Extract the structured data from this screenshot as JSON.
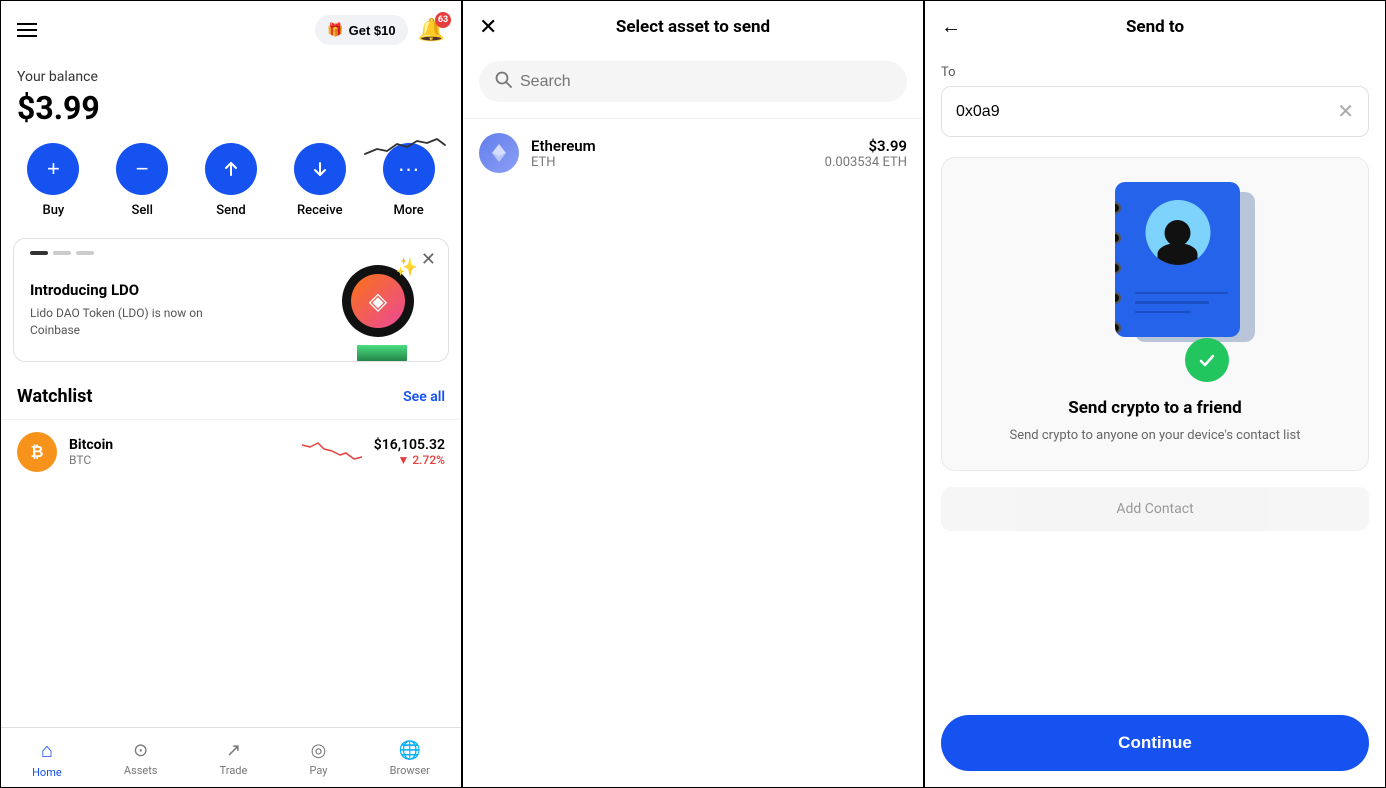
{
  "left": {
    "header": {
      "get_money_label": "Get $10",
      "notification_count": "63"
    },
    "balance": {
      "label": "Your balance",
      "amount": "$3.99"
    },
    "actions": [
      {
        "id": "buy",
        "label": "Buy",
        "icon": "+"
      },
      {
        "id": "sell",
        "label": "Sell",
        "icon": "−"
      },
      {
        "id": "send",
        "label": "Send",
        "icon": "↑"
      },
      {
        "id": "receive",
        "label": "Receive",
        "icon": "↓"
      },
      {
        "id": "more",
        "label": "More",
        "icon": "···"
      }
    ],
    "promo": {
      "title": "Introducing LDO",
      "description": "Lido DAO Token (LDO) is now on Coinbase"
    },
    "watchlist": {
      "title": "Watchlist",
      "see_all": "See all",
      "items": [
        {
          "name": "Bitcoin",
          "ticker": "BTC",
          "price": "$16,105.32",
          "change": "▼ 2.72%",
          "change_dir": "down"
        }
      ]
    },
    "nav": [
      {
        "id": "home",
        "label": "Home",
        "active": true
      },
      {
        "id": "assets",
        "label": "Assets",
        "active": false
      },
      {
        "id": "trade",
        "label": "Trade",
        "active": false
      },
      {
        "id": "pay",
        "label": "Pay",
        "active": false
      },
      {
        "id": "browser",
        "label": "Browser",
        "active": false
      }
    ]
  },
  "middle": {
    "title": "Select asset to send",
    "search_placeholder": "Search",
    "assets": [
      {
        "name": "Ethereum",
        "ticker": "ETH",
        "usd_value": "$3.99",
        "crypto_value": "0.003534 ETH"
      }
    ]
  },
  "right": {
    "title": "Send to",
    "to_label": "To",
    "to_value": "0x0a9",
    "send_friend_title": "Send crypto to a friend",
    "send_friend_desc": "Send crypto to anyone on your device's contact list",
    "add_contact_label": "Add Contact",
    "continue_label": "Continue"
  }
}
